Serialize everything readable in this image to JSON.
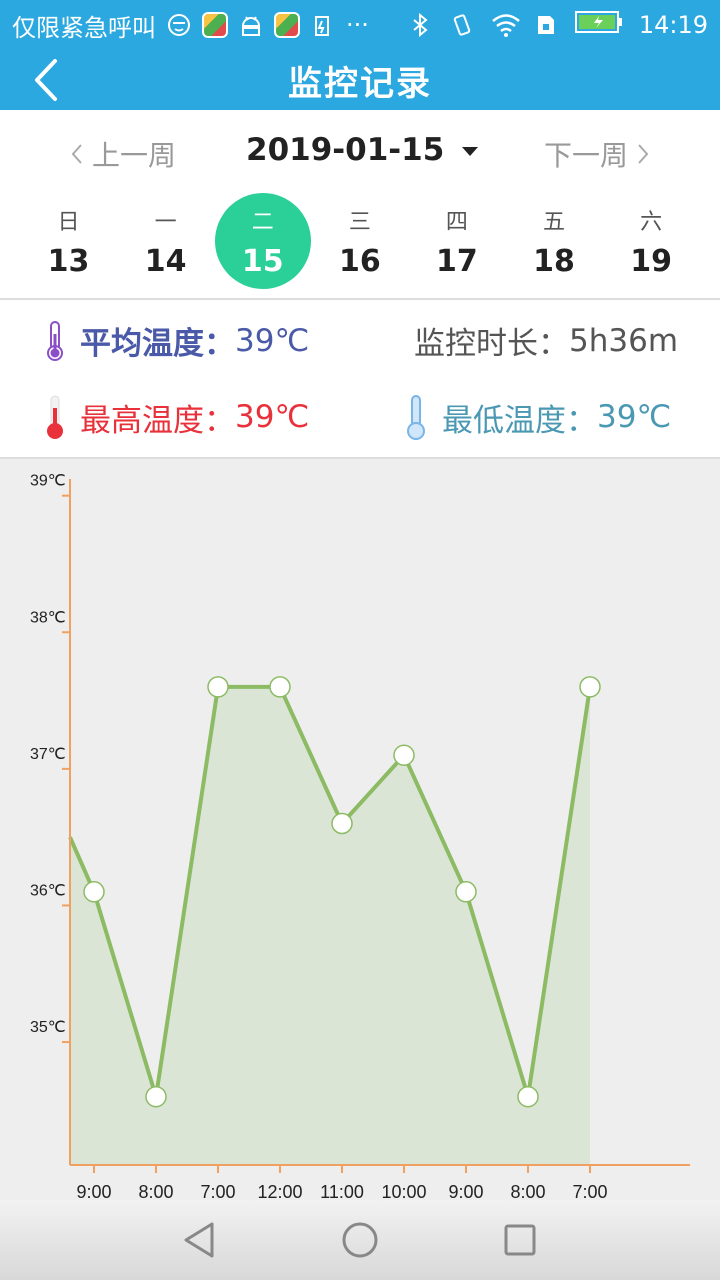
{
  "status_bar": {
    "carrier_text": "仅限紧急呼叫",
    "more": "···",
    "time": "14:19"
  },
  "header": {
    "title": "监控记录",
    "back_icon": "chevron-left-icon"
  },
  "week_nav": {
    "prev_label": "上一周",
    "next_label": "下一周",
    "selected_date": "2019-01-15"
  },
  "days": [
    {
      "weekday": "日",
      "date": "13"
    },
    {
      "weekday": "一",
      "date": "14"
    },
    {
      "weekday": "二",
      "date": "15"
    },
    {
      "weekday": "三",
      "date": "16"
    },
    {
      "weekday": "四",
      "date": "17"
    },
    {
      "weekday": "五",
      "date": "18"
    },
    {
      "weekday": "六",
      "date": "19"
    }
  ],
  "stats": {
    "avg_label": "平均温度：",
    "avg_value": "39℃",
    "duration_label": "监控时长：",
    "duration_value": "5h36m",
    "max_label": "最高温度：",
    "max_value": "39℃",
    "min_label": "最低温度：",
    "min_value": "39℃"
  },
  "colors": {
    "header_bg": "#2aa8df",
    "selected_day": "#2bcf98",
    "avg": "#4a5aa8",
    "max": "#e8313a",
    "min": "#4b98b3",
    "duration": "#555555",
    "line": "#8cbb64",
    "axis": "#f0a060"
  },
  "chart_data": {
    "type": "area",
    "x_categories": [
      "9:00",
      "8:00",
      "7:00",
      "12:00",
      "11:00",
      "10:00",
      "9:00",
      "8:00",
      "7:00"
    ],
    "y_ticks": [
      "35℃",
      "36℃",
      "37℃",
      "38℃",
      "39℃"
    ],
    "ylim": [
      34.1,
      39.1
    ],
    "series": [
      {
        "values": [
          36.1,
          34.6,
          37.6,
          37.6,
          36.6,
          37.1,
          36.1,
          34.6,
          37.6
        ],
        "leading_value": 36.5
      }
    ],
    "grid": false
  }
}
